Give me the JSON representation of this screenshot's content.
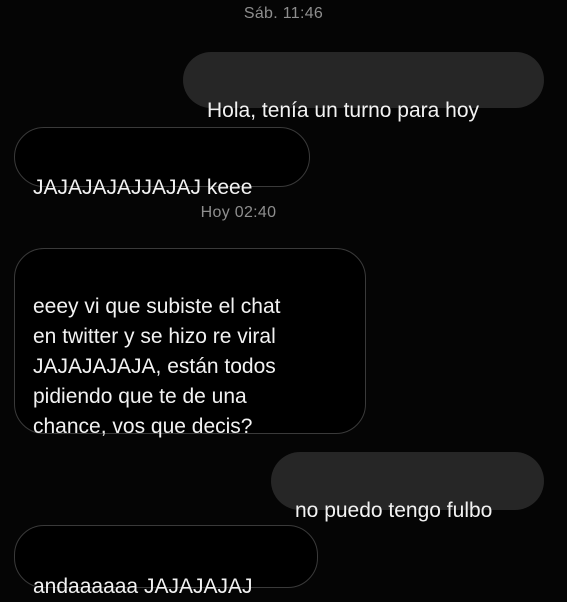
{
  "conversation": {
    "timestamps": [
      "Sáb. 11:46",
      "Hoy 02:40"
    ],
    "messages": [
      {
        "direction": "outgoing",
        "text": "Hola, tenía un turno para hoy"
      },
      {
        "direction": "incoming",
        "text": "JAJAJAJAJJAJAJ keee"
      },
      {
        "direction": "incoming",
        "text": "eeey vi que subiste el chat\nen twitter y se hizo re viral\nJAJAJAJAJA, están todos\npidiendo que te de una\nchance, vos que decis?"
      },
      {
        "direction": "outgoing",
        "text": "no puedo tengo fulbo"
      },
      {
        "direction": "incoming",
        "text": "andaaaaaa JAJAJAJAJ"
      }
    ]
  },
  "colors": {
    "background": "#050505",
    "outgoing_bubble": "#262626",
    "incoming_border": "#3a3a3a",
    "timestamp": "#8e8e8e"
  }
}
